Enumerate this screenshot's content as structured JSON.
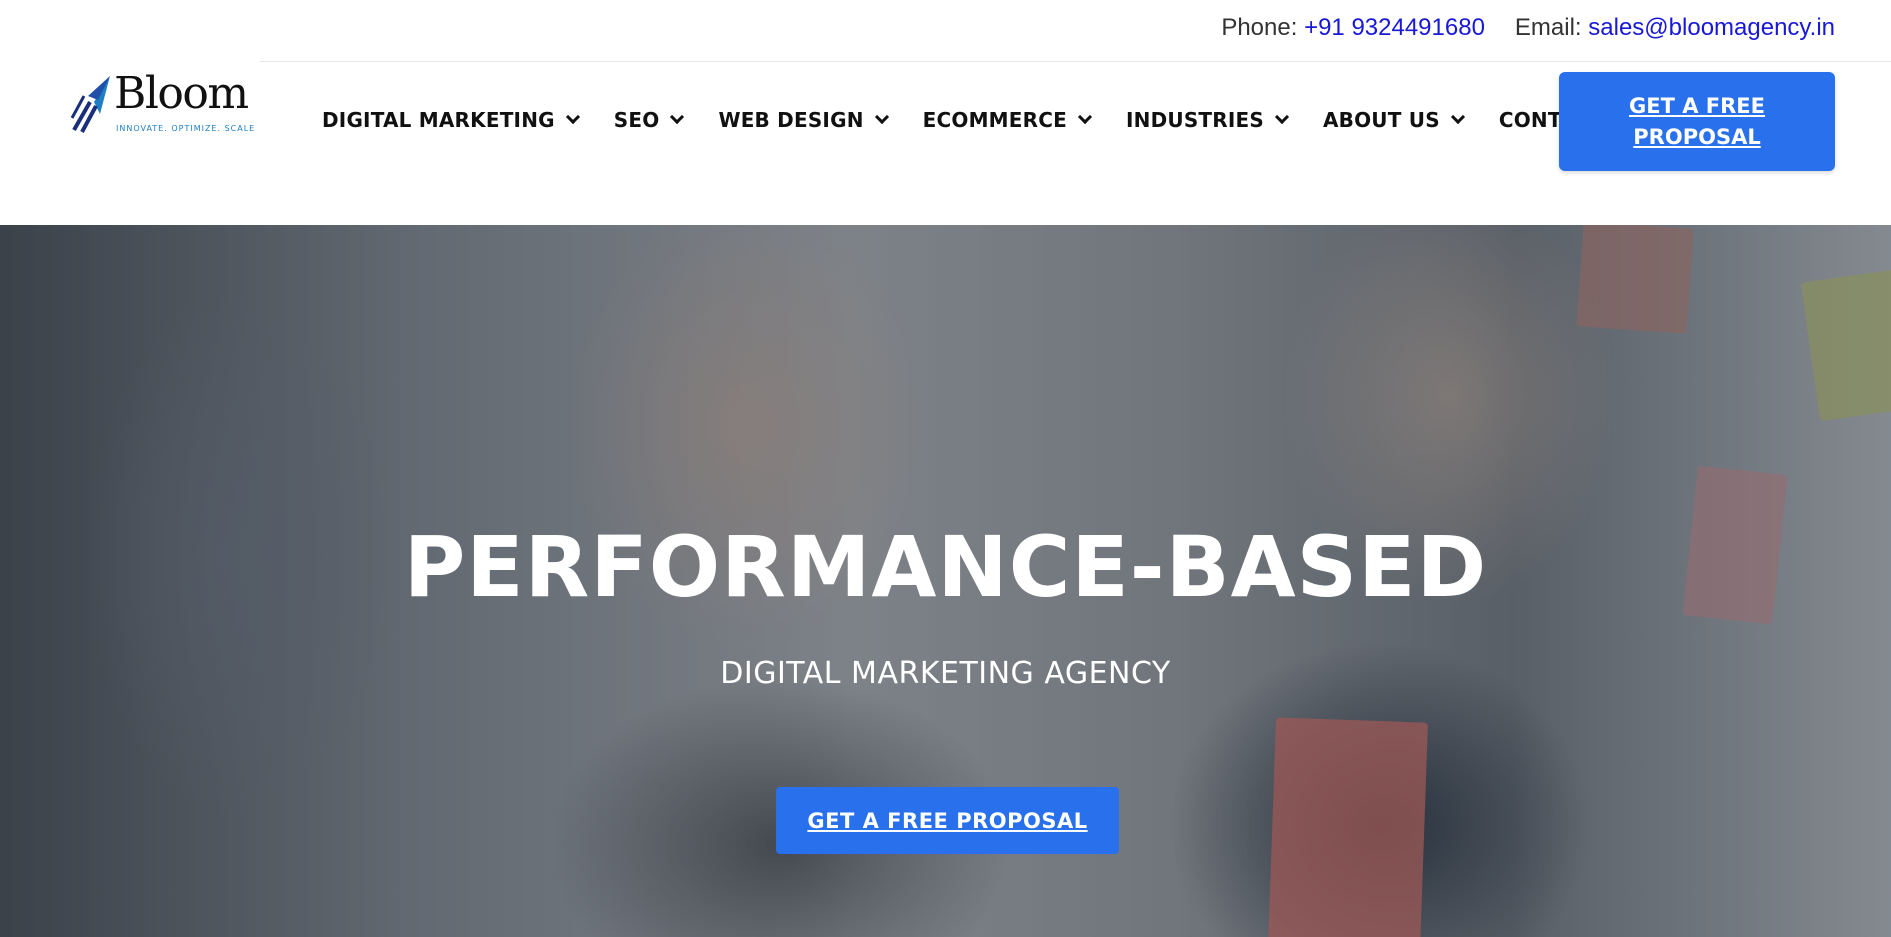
{
  "brand": {
    "name": "Bloom",
    "tagline": "INNOVATE. OPTIMIZE. SCALE"
  },
  "contact": {
    "phone_label": "Phone:",
    "phone_value": "+91 9324491680",
    "email_label": "Email:",
    "email_value": "sales@bloomagency.in"
  },
  "nav": {
    "items": [
      {
        "label": "DIGITAL MARKETING",
        "has_dropdown": true
      },
      {
        "label": "SEO",
        "has_dropdown": true
      },
      {
        "label": "WEB DESIGN",
        "has_dropdown": true
      },
      {
        "label": "ECOMMERCE",
        "has_dropdown": true
      },
      {
        "label": "INDUSTRIES",
        "has_dropdown": true
      },
      {
        "label": "ABOUT US",
        "has_dropdown": true
      },
      {
        "label": "CONTACT US",
        "has_dropdown": false
      }
    ],
    "cta_label": "GET A FREE PROPOSAL"
  },
  "hero": {
    "title": "PERFORMANCE-BASED",
    "subtitle": "DIGITAL MARKETING AGENCY",
    "cta_label": "GET A FREE PROPOSAL"
  },
  "colors": {
    "accent": "#2970ec",
    "link": "#1818d6",
    "logo_mark": "#1f4fa8"
  }
}
